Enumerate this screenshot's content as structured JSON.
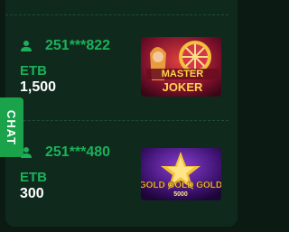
{
  "chat": {
    "label": "CHAT"
  },
  "wins": [
    {
      "user": "251***822",
      "currency": "ETB",
      "amount": "1,500",
      "game_icon": "master-joker-thumbnail",
      "game_text": [
        "MASTER",
        "JOKER"
      ]
    },
    {
      "user": "251***480",
      "currency": "ETB",
      "amount": "300",
      "game_icon": "gold-gold-gold-thumbnail",
      "game_text": [
        "GOLD GOLD GOLD",
        "5000"
      ]
    }
  ],
  "colors": {
    "accent": "#1bb15a",
    "background": "#0f2a1d",
    "chat_tab": "#1aa34a"
  }
}
